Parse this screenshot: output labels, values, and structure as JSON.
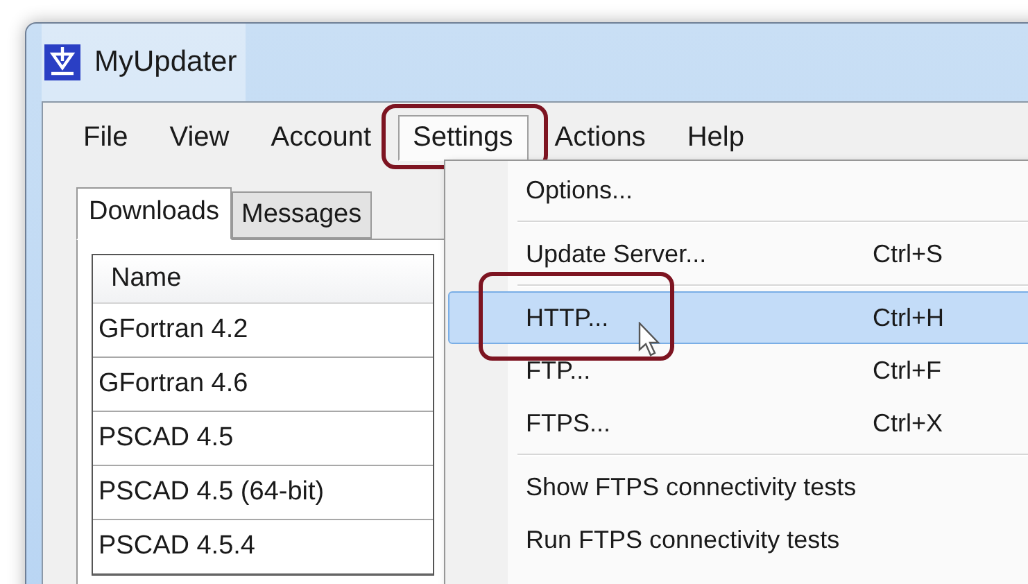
{
  "window": {
    "title": "MyUpdater"
  },
  "menu_bar": [
    {
      "label": "File",
      "selected": false
    },
    {
      "label": "View",
      "selected": false
    },
    {
      "label": "Account",
      "selected": false
    },
    {
      "label": "Settings",
      "selected": true,
      "circled": true
    },
    {
      "label": "Actions",
      "selected": false
    },
    {
      "label": "Help",
      "selected": false
    }
  ],
  "tabs": [
    {
      "label": "Downloads",
      "selected": true
    },
    {
      "label": "Messages",
      "selected": false
    }
  ],
  "table": {
    "columns": [
      "Name"
    ],
    "rows": [
      "GFortran 4.2",
      "GFortran 4.6",
      "PSCAD 4.5",
      "PSCAD 4.5 (64-bit)",
      "PSCAD 4.5.4"
    ]
  },
  "dropdown": [
    {
      "kind": "item",
      "label": "Options...",
      "selected": false
    },
    {
      "kind": "separator"
    },
    {
      "kind": "item",
      "label": "Update Server...",
      "shortcut": "Ctrl+S",
      "selected": false
    },
    {
      "kind": "separator"
    },
    {
      "kind": "item",
      "label": "HTTP...",
      "shortcut": "Ctrl+H",
      "selected": true,
      "circled": true
    },
    {
      "kind": "item",
      "label": "FTP...",
      "shortcut": "Ctrl+F",
      "selected": false
    },
    {
      "kind": "item",
      "label": "FTPS...",
      "shortcut": "Ctrl+X",
      "selected": false
    },
    {
      "kind": "separator"
    },
    {
      "kind": "item",
      "label": "Show FTPS connectivity tests",
      "selected": false
    },
    {
      "kind": "item",
      "label": "Run FTPS connectivity tests",
      "selected": false
    }
  ]
}
